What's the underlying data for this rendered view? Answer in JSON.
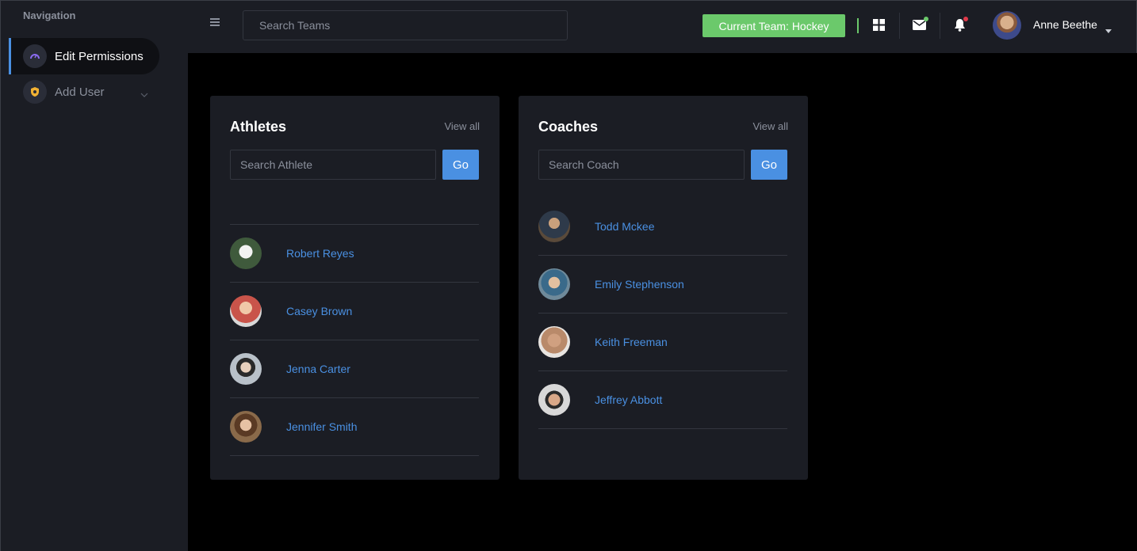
{
  "sidebar": {
    "heading": "Navigation",
    "items": [
      {
        "label": "Edit Permissions",
        "icon": "gauge-icon",
        "active": true
      },
      {
        "label": "Add User",
        "icon": "shield-icon",
        "active": false
      }
    ]
  },
  "header": {
    "search_placeholder": "Search Teams",
    "team_badge": "Current Team: Hockey",
    "user_name": "Anne Beethe",
    "colors": {
      "accent": "#4a90e2",
      "team_badge": "#6bc96b",
      "mail_dot": "#6bc96b",
      "bell_dot": "#e0394a"
    }
  },
  "athletes": {
    "title": "Athletes",
    "view_all": "View all",
    "search_placeholder": "Search Athlete",
    "go_label": "Go",
    "people": [
      {
        "name": "Robert Reyes",
        "avatar_color": "#3f5a3c"
      },
      {
        "name": "Casey Brown",
        "avatar_color": "#c9544a"
      },
      {
        "name": "Jenna Carter",
        "avatar_color": "#b9c1c9"
      },
      {
        "name": "Jennifer Smith",
        "avatar_color": "#8a6a4a"
      }
    ]
  },
  "coaches": {
    "title": "Coaches",
    "view_all": "View all",
    "search_placeholder": "Search Coach",
    "go_label": "Go",
    "people": [
      {
        "name": "Todd Mckee",
        "avatar_color": "#5a4a3a"
      },
      {
        "name": "Emily Stephenson",
        "avatar_color": "#6f8a9a"
      },
      {
        "name": "Keith Freeman",
        "avatar_color": "#b98a6a"
      },
      {
        "name": "Jeffrey Abbott",
        "avatar_color": "#d8d8d8"
      }
    ]
  }
}
